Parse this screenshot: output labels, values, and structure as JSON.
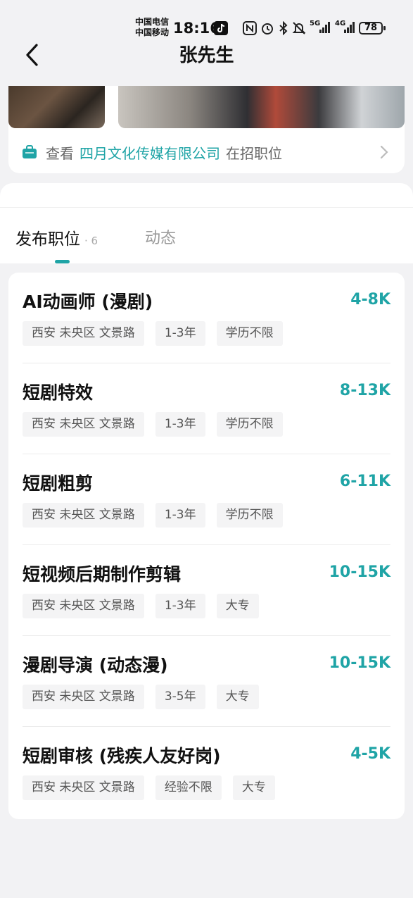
{
  "status_bar": {
    "carrier_1": "中国电信",
    "carrier_2": "中国移动",
    "time": "18:16",
    "signal_5g": "5G",
    "signal_4g": "4G",
    "battery": "78"
  },
  "header": {
    "title": "张先生"
  },
  "company": {
    "prefix": "查看",
    "name": "四月文化传媒有限公司",
    "suffix": "在招职位"
  },
  "tabs": [
    {
      "label": "发布职位",
      "count": "· 6"
    },
    {
      "label": "动态"
    }
  ],
  "colors": {
    "accent": "#1fa4a6",
    "tag_bg": "#f4f4f5",
    "page_bg": "#f2f2f4"
  },
  "jobs": [
    {
      "title": "AI动画师 (漫剧)",
      "salary": "4-8K",
      "tags": [
        "西安 未央区 文景路",
        "1-3年",
        "学历不限"
      ]
    },
    {
      "title": "短剧特效",
      "salary": "8-13K",
      "tags": [
        "西安 未央区 文景路",
        "1-3年",
        "学历不限"
      ]
    },
    {
      "title": "短剧粗剪",
      "salary": "6-11K",
      "tags": [
        "西安 未央区 文景路",
        "1-3年",
        "学历不限"
      ]
    },
    {
      "title": "短视频后期制作剪辑",
      "salary": "10-15K",
      "tags": [
        "西安 未央区 文景路",
        "1-3年",
        "大专"
      ]
    },
    {
      "title": "漫剧导演 (动态漫)",
      "salary": "10-15K",
      "tags": [
        "西安 未央区 文景路",
        "3-5年",
        "大专"
      ]
    },
    {
      "title": "短剧审核 (残疾人友好岗)",
      "salary": "4-5K",
      "tags": [
        "西安 未央区 文景路",
        "经验不限",
        "大专"
      ]
    }
  ]
}
